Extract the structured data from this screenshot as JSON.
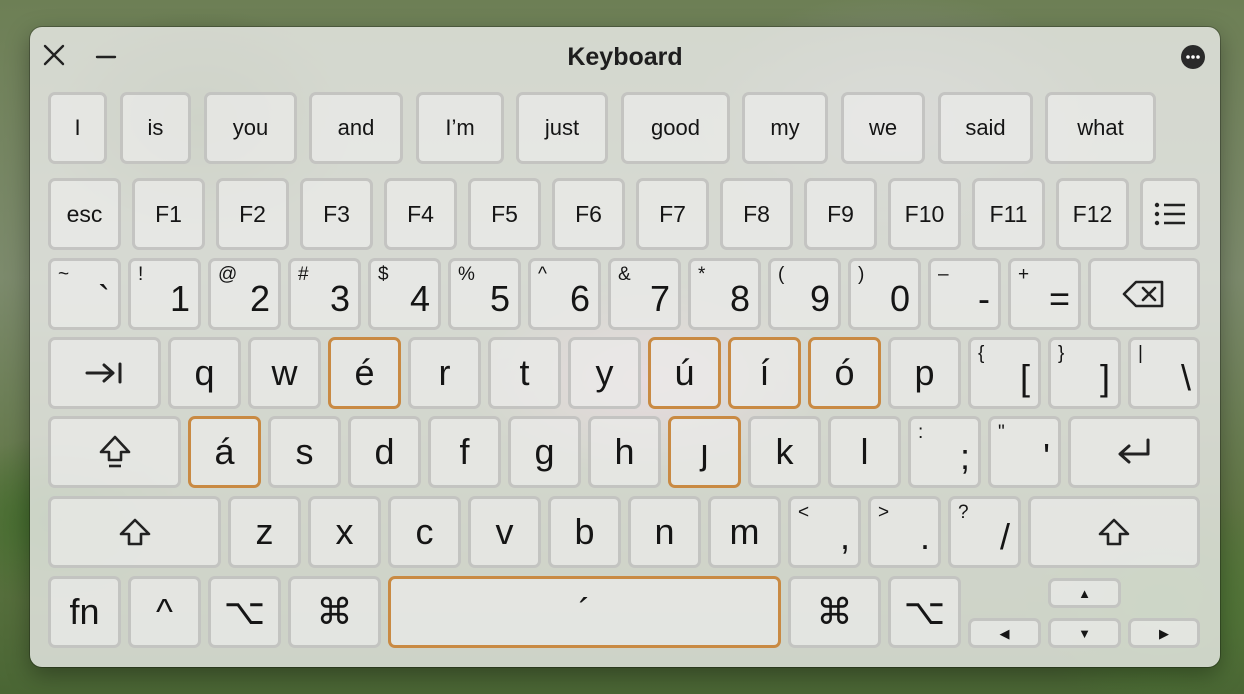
{
  "window": {
    "title": "Keyboard"
  },
  "suggestions": [
    "I",
    "is",
    "you",
    "and",
    "I’m",
    "just",
    "good",
    "my",
    "we",
    "said",
    "what"
  ],
  "function_row": [
    "esc",
    "F1",
    "F2",
    "F3",
    "F4",
    "F5",
    "F6",
    "F7",
    "F8",
    "F9",
    "F10",
    "F11",
    "F12"
  ],
  "number_row": [
    {
      "shift": "~",
      "base": "`"
    },
    {
      "shift": "!",
      "base": "1"
    },
    {
      "shift": "@",
      "base": "2"
    },
    {
      "shift": "#",
      "base": "3"
    },
    {
      "shift": "$",
      "base": "4"
    },
    {
      "shift": "%",
      "base": "5"
    },
    {
      "shift": "^",
      "base": "6"
    },
    {
      "shift": "&",
      "base": "7"
    },
    {
      "shift": "*",
      "base": "8"
    },
    {
      "shift": "(",
      "base": "9"
    },
    {
      "shift": ")",
      "base": "0"
    },
    {
      "shift": "–",
      "base": "-"
    },
    {
      "shift": "+",
      "base": "="
    }
  ],
  "row_q": [
    "q",
    "w",
    "é",
    "r",
    "t",
    "y",
    "ú",
    "í",
    "ó",
    "p"
  ],
  "row_q_brackets": [
    {
      "shift": "{",
      "base": "["
    },
    {
      "shift": "}",
      "base": "]"
    },
    {
      "shift": "|",
      "base": "\\"
    }
  ],
  "row_a": [
    "á",
    "s",
    "d",
    "f",
    "g",
    "h",
    "ȷ",
    "k",
    "l"
  ],
  "row_a_punct": [
    {
      "shift": ":",
      "base": ";"
    },
    {
      "shift": "\"",
      "base": "'"
    }
  ],
  "row_z": [
    "z",
    "x",
    "c",
    "v",
    "b",
    "n",
    "m"
  ],
  "row_z_punct": [
    {
      "shift": "<",
      "base": ","
    },
    {
      "shift": ">",
      "base": "."
    },
    {
      "shift": "?",
      "base": "/"
    }
  ],
  "bottom": {
    "fn": "fn",
    "control": "^",
    "option_left": "⌥",
    "command_left": "⌘",
    "space": "´",
    "command_right": "⌘",
    "option_right": "⌥"
  },
  "arrows": {
    "up": "▲",
    "left": "◀",
    "down": "▼",
    "right": "▶"
  },
  "highlighted_keys": [
    "é",
    "ú",
    "í",
    "ó",
    "á",
    "ȷ",
    "space"
  ],
  "colors": {
    "highlight": "#c98a43",
    "key_border": "#bebebc"
  }
}
